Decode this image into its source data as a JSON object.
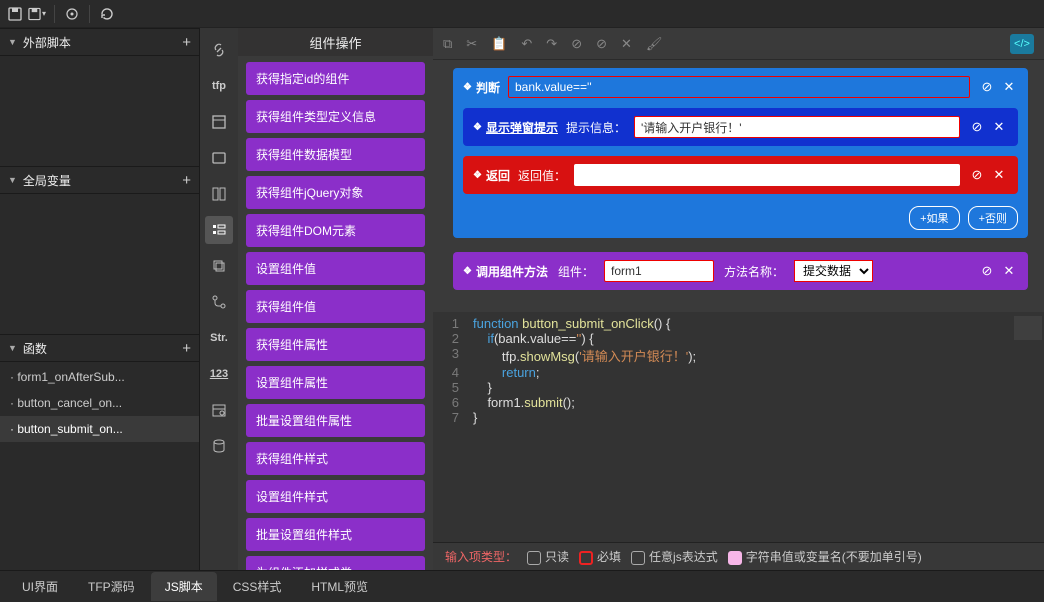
{
  "topbar": {
    "save_icon": "save",
    "save_dd_icon": "save",
    "target_icon": "target",
    "refresh_icon": "refresh"
  },
  "sections": {
    "external": {
      "title": "外部脚本"
    },
    "globals": {
      "title": "全局变量"
    },
    "funcs": {
      "title": "函数",
      "items": [
        {
          "label": "· form1_onAfterSub..."
        },
        {
          "label": "· button_cancel_on..."
        },
        {
          "label": "· button_submit_on..."
        }
      ]
    }
  },
  "rail": {
    "tfp": "tfp",
    "str": "Str.",
    "num": "123"
  },
  "ops": {
    "title": "组件操作",
    "items": [
      "获得指定id的组件",
      "获得组件类型定义信息",
      "获得组件数据模型",
      "获得组件jQuery对象",
      "获得组件DOM元素",
      "设置组件值",
      "获得组件值",
      "获得组件属性",
      "设置组件属性",
      "批量设置组件属性",
      "获得组件样式",
      "设置组件样式",
      "批量设置组件样式",
      "为组件添加样式类"
    ]
  },
  "judge": {
    "label": "判断",
    "expr": "bank.value==''",
    "msg_label": "显示弹窗提示",
    "msg_field_label": "提示信息：",
    "msg_value": "'请输入开户银行！'",
    "return_label": "返回",
    "return_field_label": "返回值：",
    "return_value": "",
    "btn_if": "+如果",
    "btn_else": "+否则"
  },
  "call": {
    "label": "调用组件方法",
    "comp_label": "组件：",
    "comp_value": "form1",
    "method_label": "方法名称：",
    "method_value": "提交数据"
  },
  "code": {
    "lines": [
      {
        "n": "1",
        "html": "<span class='kw'>function</span> <span class='fn'>button_submit_onClick</span>() {"
      },
      {
        "n": "2",
        "html": "    <span class='kw'>if</span>(bank.value==<span class='str'>''</span>) {"
      },
      {
        "n": "3",
        "html": "        tfp.<span class='fn'>showMsg</span>(<span class='str'>'请输入开户银行！'</span>);"
      },
      {
        "n": "4",
        "html": "        <span class='kw'>return</span>;"
      },
      {
        "n": "5",
        "html": "    }"
      },
      {
        "n": "6",
        "html": "    form1.<span class='fn'>submit</span>();"
      },
      {
        "n": "7",
        "html": "}"
      }
    ]
  },
  "footer": {
    "label": "输入项类型：",
    "opt_readonly": "只读",
    "opt_required": "必填",
    "opt_js": "任意js表达式",
    "opt_str": "字符串值或变量名(不要加单引号)"
  },
  "tabs": {
    "ui": "UI界面",
    "tfp": "TFP源码",
    "js": "JS脚本",
    "css": "CSS样式",
    "html": "HTML预览"
  }
}
